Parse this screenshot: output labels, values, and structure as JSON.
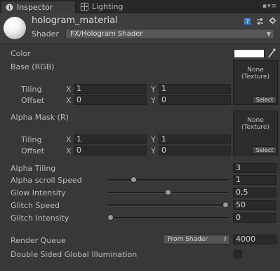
{
  "tabs": [
    {
      "label": "Inspector",
      "icon": "info-icon",
      "active": true
    },
    {
      "label": "Lighting",
      "icon": "lighting-grid-icon",
      "active": false
    }
  ],
  "header": {
    "material_name": "hologram_material",
    "shader_label": "Shader",
    "shader_value": "FX/Hologram Shader",
    "icons": [
      "help-book-icon",
      "preset-settings-icon",
      "gear-icon"
    ]
  },
  "properties": {
    "color": {
      "label": "Color",
      "value": "#ffffff"
    },
    "base": {
      "label": "Base (RGB)",
      "texture_line1": "None",
      "texture_line2": "(Texture)",
      "select_label": "Select",
      "tiling_label": "Tiling",
      "tiling_x": "1",
      "tiling_y": "1",
      "offset_label": "Offset",
      "offset_x": "0",
      "offset_y": "0"
    },
    "alpha_mask": {
      "label": "Alpha Mask (R)",
      "texture_line1": "None",
      "texture_line2": "(Texture)",
      "select_label": "Select",
      "tiling_label": "Tiling",
      "tiling_x": "1",
      "tiling_y": "1",
      "offset_label": "Offset",
      "offset_x": "0",
      "offset_y": "0"
    },
    "axis_x": "X",
    "axis_y": "Y",
    "alpha_tiling": {
      "label": "Alpha Tiling",
      "value": "3"
    },
    "alpha_scroll_speed": {
      "label": "Alpha scroll Speed",
      "value": "1",
      "slider_fraction": 0.2
    },
    "glow_intensity": {
      "label": "Glow Intensity",
      "value": "0,5",
      "slider_fraction": 0.5
    },
    "glitch_speed": {
      "label": "Glitch Speed",
      "value": "50",
      "slider_fraction": 1.0
    },
    "glitch_intensity": {
      "label": "Glitch Intensity",
      "value": "0",
      "slider_fraction": 0.0
    },
    "render_queue": {
      "label": "Render Queue",
      "dropdown": "From Shader",
      "value": "4000"
    },
    "double_sided_gi": {
      "label": "Double Sided Global Illumination",
      "checked": false
    }
  }
}
